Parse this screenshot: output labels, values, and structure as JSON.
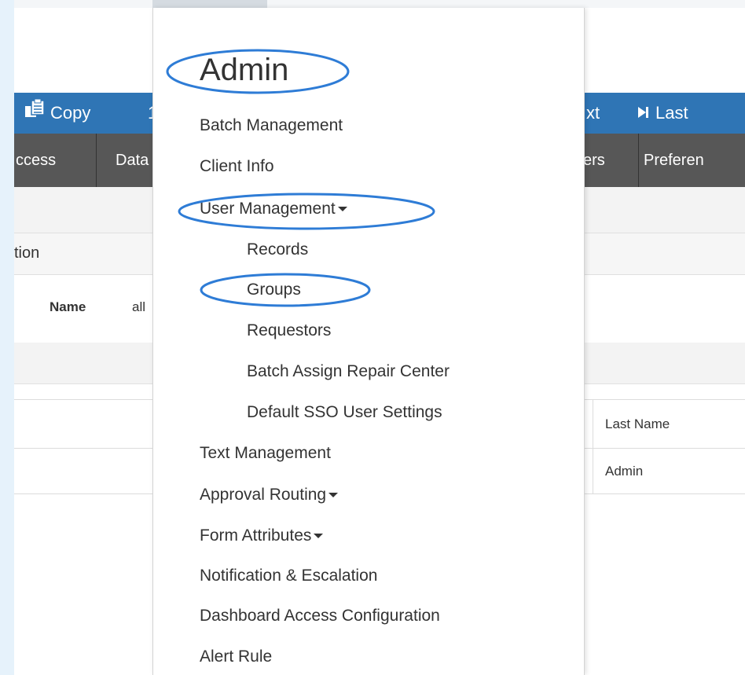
{
  "toolbar": {
    "copy_label": "Copy",
    "partial_label": "1",
    "next_partial_label": "xt",
    "last_label": "Last"
  },
  "tabs": {
    "access_partial": "ccess",
    "data_partial": "Data",
    "users_partial": "ers",
    "preferences_partial": "Preferen"
  },
  "content": {
    "section_partial": "tion",
    "name_label": "Name",
    "name_value_partial": "all",
    "table": {
      "col_last_name": "Last Name",
      "row1_last_name": "Admin"
    }
  },
  "menu": {
    "title": "Admin",
    "items": [
      {
        "label": "Batch Management"
      },
      {
        "label": "Client Info"
      },
      {
        "label": "User Management",
        "has_submenu": true
      },
      {
        "label": "Records"
      },
      {
        "label": "Groups"
      },
      {
        "label": "Requestors"
      },
      {
        "label": "Batch Assign Repair Center"
      },
      {
        "label": "Default SSO User Settings"
      },
      {
        "label": "Text Management"
      },
      {
        "label": "Approval Routing",
        "has_submenu": true
      },
      {
        "label": "Form Attributes",
        "has_submenu": true
      },
      {
        "label": "Notification & Escalation"
      },
      {
        "label": "Dashboard Access Configuration"
      },
      {
        "label": "Alert Rule"
      }
    ]
  },
  "colors": {
    "toolbar": "#2f75b5",
    "tabs": "#575757",
    "highlight_oval": "#2e7cd6",
    "page_margin": "#e6f2fb"
  }
}
